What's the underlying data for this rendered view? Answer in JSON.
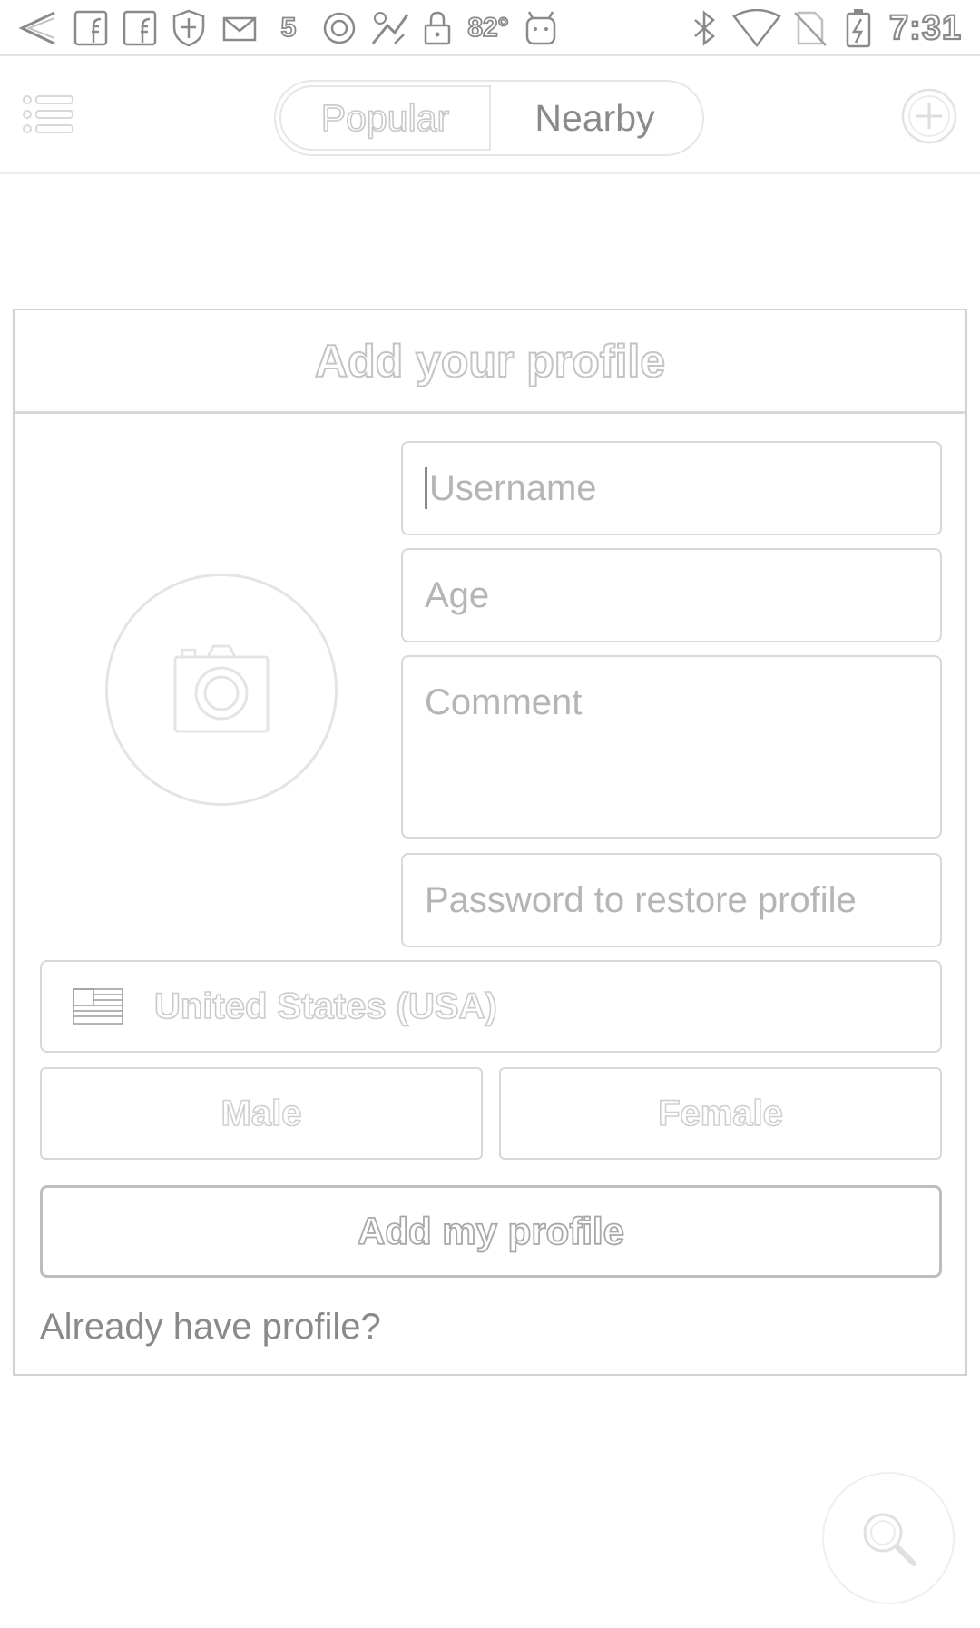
{
  "status_bar": {
    "icons": [
      "back-arrow-icon",
      "facebook-icon",
      "facebook-icon",
      "shield-icon",
      "mail-icon",
      "notification-5-icon",
      "sync-icon",
      "weather-icon",
      "lock-icon",
      "android-icon",
      "bluetooth-icon",
      "wifi-icon",
      "no-sim-icon",
      "battery-charging-icon"
    ],
    "notification_count": "5",
    "temperature": "82°",
    "time": "7:31"
  },
  "top_bar": {
    "tabs": [
      {
        "label": "Popular",
        "active": true
      },
      {
        "label": "Nearby",
        "active": false
      }
    ],
    "menu_icon": "list-menu-icon",
    "add_icon": "plus-circle-icon"
  },
  "card": {
    "title": "Add your profile",
    "photo_icon": "camera-icon",
    "username_placeholder": "Username",
    "age_placeholder": "Age",
    "comment_placeholder": "Comment",
    "password_placeholder": "Password to restore profile",
    "country": "United States (USA)",
    "country_flag_icon": "us-flag-icon",
    "male_label": "Male",
    "female_label": "Female",
    "submit_label": "Add my profile",
    "already_label": "Already have profile?"
  },
  "fab": {
    "icon": "search-icon"
  },
  "colors": {
    "background": "#ffffff",
    "border": "#d8d8d8",
    "text": "#7a7a7a"
  }
}
